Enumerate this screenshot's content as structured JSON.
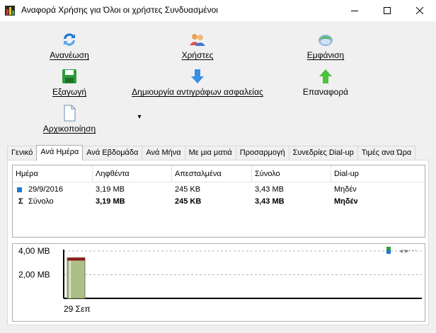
{
  "window": {
    "title": "Αναφορά Χρήσης για Όλοι οι χρήστες Συνδυασμένοι",
    "minimize_glyph": "—",
    "maximize_glyph": "☐",
    "close_glyph": "✕"
  },
  "toolbar": {
    "refresh": "Ανανέωση",
    "users": "Χρήστες",
    "appearance": "Εμφάνιση",
    "export": "Εξαγωγή",
    "backup": "Δημιουργία αντιγράφων ασφαλείας",
    "restore": "Επαναφορά",
    "reset": "Αρχικοποίηση",
    "more_glyph": "▾"
  },
  "tabs": [
    {
      "label": "Γενικό",
      "active": false
    },
    {
      "label": "Ανά Ημέρα",
      "active": true
    },
    {
      "label": "Ανά Εβδομάδα",
      "active": false
    },
    {
      "label": "Ανά Μήνα",
      "active": false
    },
    {
      "label": "Με μια ματιά",
      "active": false
    },
    {
      "label": "Προσαρμογή",
      "active": false
    },
    {
      "label": "Συνεδρίες Dial-up",
      "active": false
    },
    {
      "label": "Τιμές ανα Ώρα",
      "active": false
    }
  ],
  "table": {
    "columns": [
      "Ημέρα",
      "Ληφθέντα",
      "Απεσταλμένα",
      "Σύνολο",
      "Dial-up"
    ],
    "rows": [
      {
        "day": "29/9/2016",
        "received": "3,19 MB",
        "sent": "245 KB",
        "total": "3,43 MB",
        "dialup": "Μηδέν"
      }
    ],
    "total_row": {
      "symbol": "Σ",
      "day": "Σύνολο",
      "received": "3,19 MB",
      "sent": "245 KB",
      "total": "3,43 MB",
      "dialup": "Μηδέν"
    }
  },
  "chart_data": {
    "type": "bar",
    "categories": [
      "29 Σεπ"
    ],
    "series": [
      {
        "values": [
          3.43
        ],
        "color": "#aebe8a"
      }
    ],
    "received_line": 3.19,
    "y_tick_labels": [
      "4,00 MB",
      "2,00 MB"
    ],
    "ylim": [
      0,
      4
    ],
    "grid": true,
    "legend_glyph": "◂ ▸"
  },
  "colors": {
    "accent_blue": "#1e77d3",
    "bar_fill": "#aebe8a",
    "bar_top": "#8b1d1d"
  }
}
